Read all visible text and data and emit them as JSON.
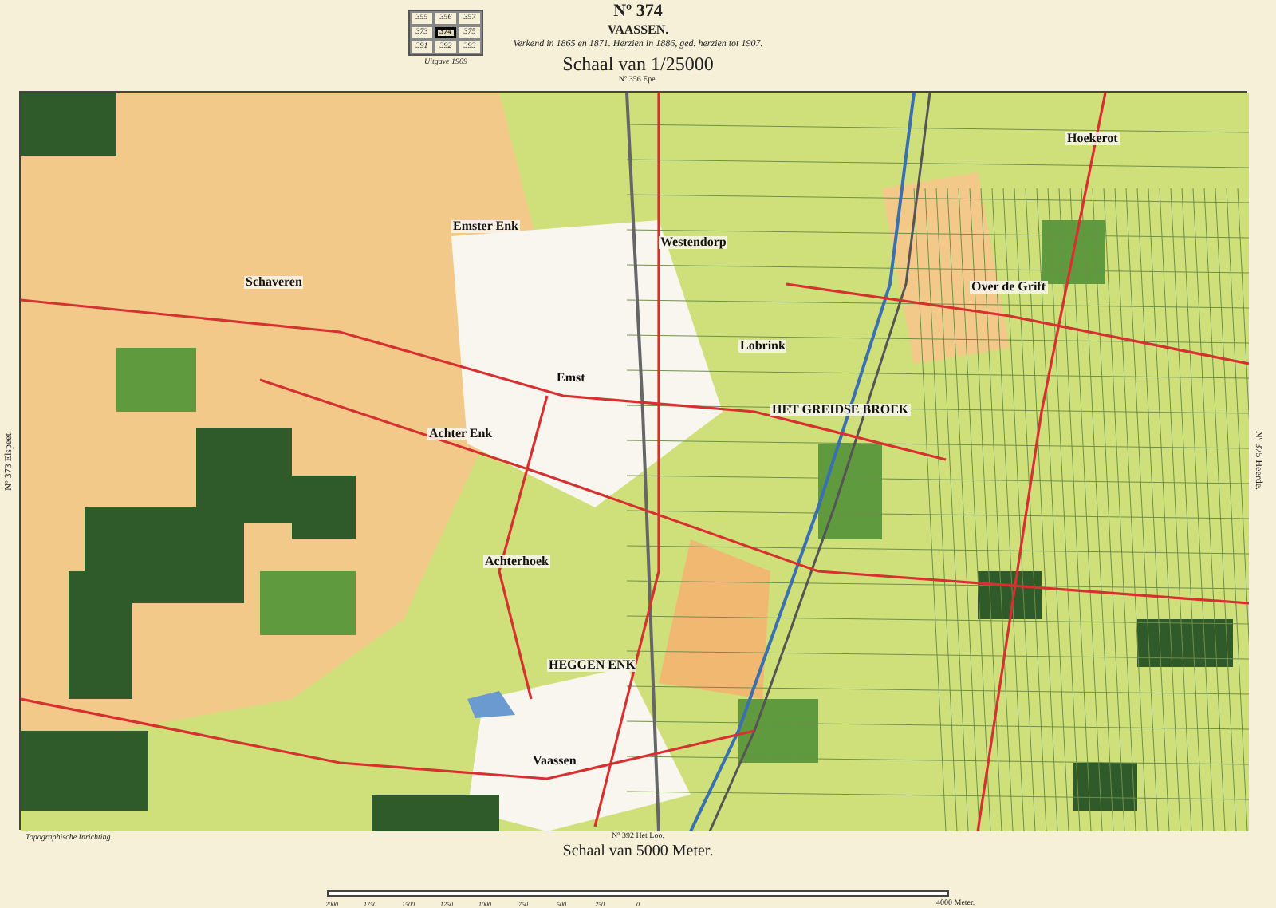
{
  "sheet_index": {
    "cells": [
      [
        {
          "text": "355",
          "selected": false
        },
        {
          "text": "356",
          "selected": false
        },
        {
          "text": "357",
          "selected": false
        }
      ],
      [
        {
          "text": "373",
          "selected": false
        },
        {
          "text": "374",
          "selected": true
        },
        {
          "text": "375",
          "selected": false
        }
      ],
      [
        {
          "text": "391",
          "selected": false
        },
        {
          "text": "392",
          "selected": false
        },
        {
          "text": "393",
          "selected": false
        }
      ]
    ],
    "caption": "Uitgave 1909"
  },
  "title": {
    "number": "Nº 374",
    "name": "VAASSEN.",
    "subtitle": "Verkend in 1865 en 1871. Herzien in 1886, ged. herzien tot 1907.",
    "scale": "Schaal van 1/25000"
  },
  "neighbors": {
    "top": "Nº 356 Epe.",
    "left": "Nº 373 Elspeet.",
    "right": "Nº 375 Heerde.",
    "bottom": "Nº 392 Het Loo."
  },
  "map": {
    "labels": [
      {
        "text": "Emster Enk"
      },
      {
        "text": "Westendorp"
      },
      {
        "text": "Schaveren"
      },
      {
        "text": "Over de Grift"
      },
      {
        "text": "Lobrink"
      },
      {
        "text": "Emst"
      },
      {
        "text": "Achter Enk"
      },
      {
        "text": "Achterhoek"
      },
      {
        "text": "Vaassen"
      },
      {
        "text": "Hoekerot"
      },
      {
        "text": "HET GREIDSE BROEK"
      },
      {
        "text": "HEGGEN ENK"
      }
    ]
  },
  "footer": {
    "credit": "Topographische Inrichting.",
    "scale_title": "Schaal van 5000 Meter.",
    "ticks": [
      "2000",
      "1750",
      "1500",
      "1250",
      "1000",
      "750",
      "500",
      "250",
      "0"
    ],
    "end_label": "4000 Meter."
  }
}
